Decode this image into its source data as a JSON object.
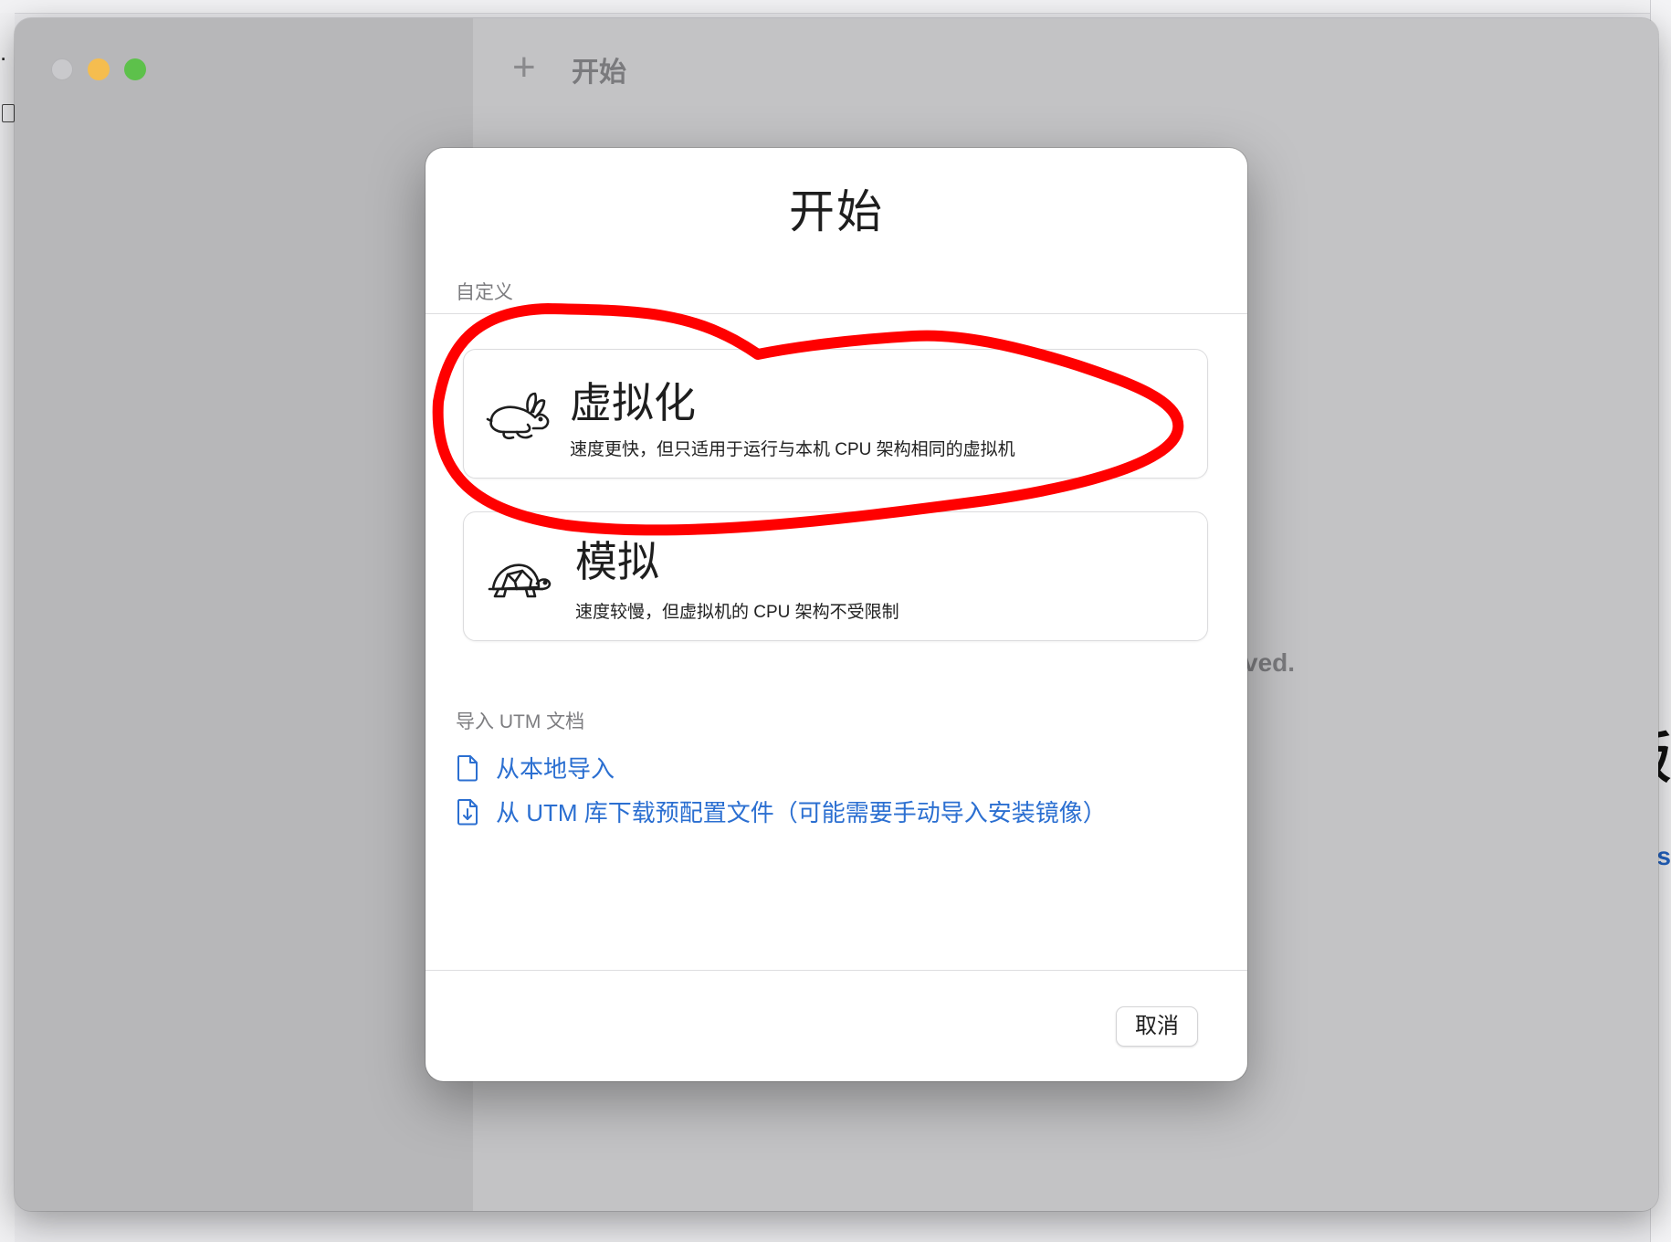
{
  "window": {
    "toolbar_title": "开始",
    "toolbar_add_icon": "plus-icon",
    "background_partial_text": "ved."
  },
  "background": {
    "right_partial_text_s": "s",
    "right_partial_text_big": "版"
  },
  "sheet": {
    "title": "开始",
    "custom_section_label": "自定义",
    "options": [
      {
        "icon": "rabbit-icon",
        "title": "虚拟化",
        "description": "速度更快，但只适用于运行与本机 CPU 架构相同的虚拟机"
      },
      {
        "icon": "turtle-icon",
        "title": "模拟",
        "description": "速度较慢，但虚拟机的 CPU 架构不受限制"
      }
    ],
    "import_section_label": "导入 UTM 文档",
    "import_links": [
      {
        "icon": "document-icon",
        "label": "从本地导入"
      },
      {
        "icon": "document-download-icon",
        "label": "从 UTM 库下载预配置文件（可能需要手动导入安装镜像）"
      }
    ],
    "cancel_label": "取消"
  },
  "colors": {
    "accent_link": "#2b6fd1",
    "annotation_red": "#ff0000",
    "traffic_close": "#c9c9cc",
    "traffic_minimize": "#f5bd4f",
    "traffic_maximize": "#5dc14b"
  }
}
